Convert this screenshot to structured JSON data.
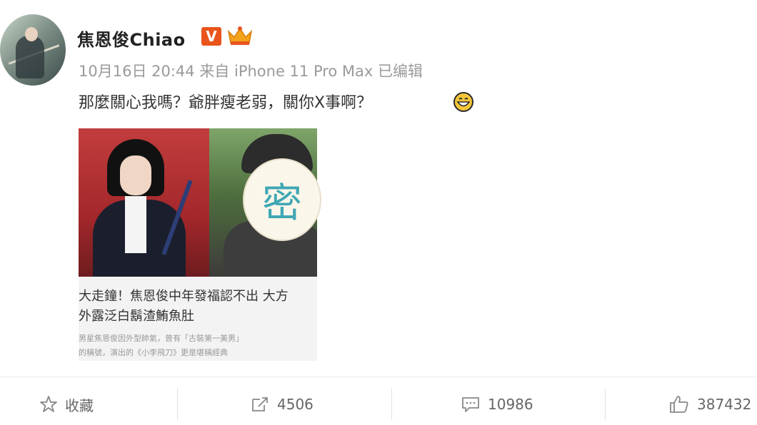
{
  "post": {
    "author": "焦恩俊Chiao",
    "badge_v": "V",
    "meta": "10月16日 20:44 来自 iPhone 11 Pro Max   已编辑",
    "text": "那麼關心我嗎？爺胖瘦老弱，關你X事啊？"
  },
  "card": {
    "blur_char": "密",
    "title_line1": "大走鐘！焦恩俊中年發福認不出 大方",
    "title_line2": "外露泛白鬍渣鮪魚肚",
    "desc_line1": "男星焦恩俊因外型帥氣，曾有「古裝第一美男」",
    "desc_line2": "的稱號，演出的《小李飛刀》更是堪稱經典"
  },
  "actions": {
    "favorite_label": "收藏",
    "repost_count": "4506",
    "comment_count": "10986",
    "like_count": "387432"
  },
  "colors": {
    "badge_orange": "#e8541b",
    "muted_text": "#9a9a9a",
    "body_text": "#333333"
  },
  "icons": [
    "star-icon",
    "repost-icon",
    "comment-icon",
    "thumbs-up-icon",
    "grin-emoji-icon",
    "crown-badge-icon"
  ]
}
